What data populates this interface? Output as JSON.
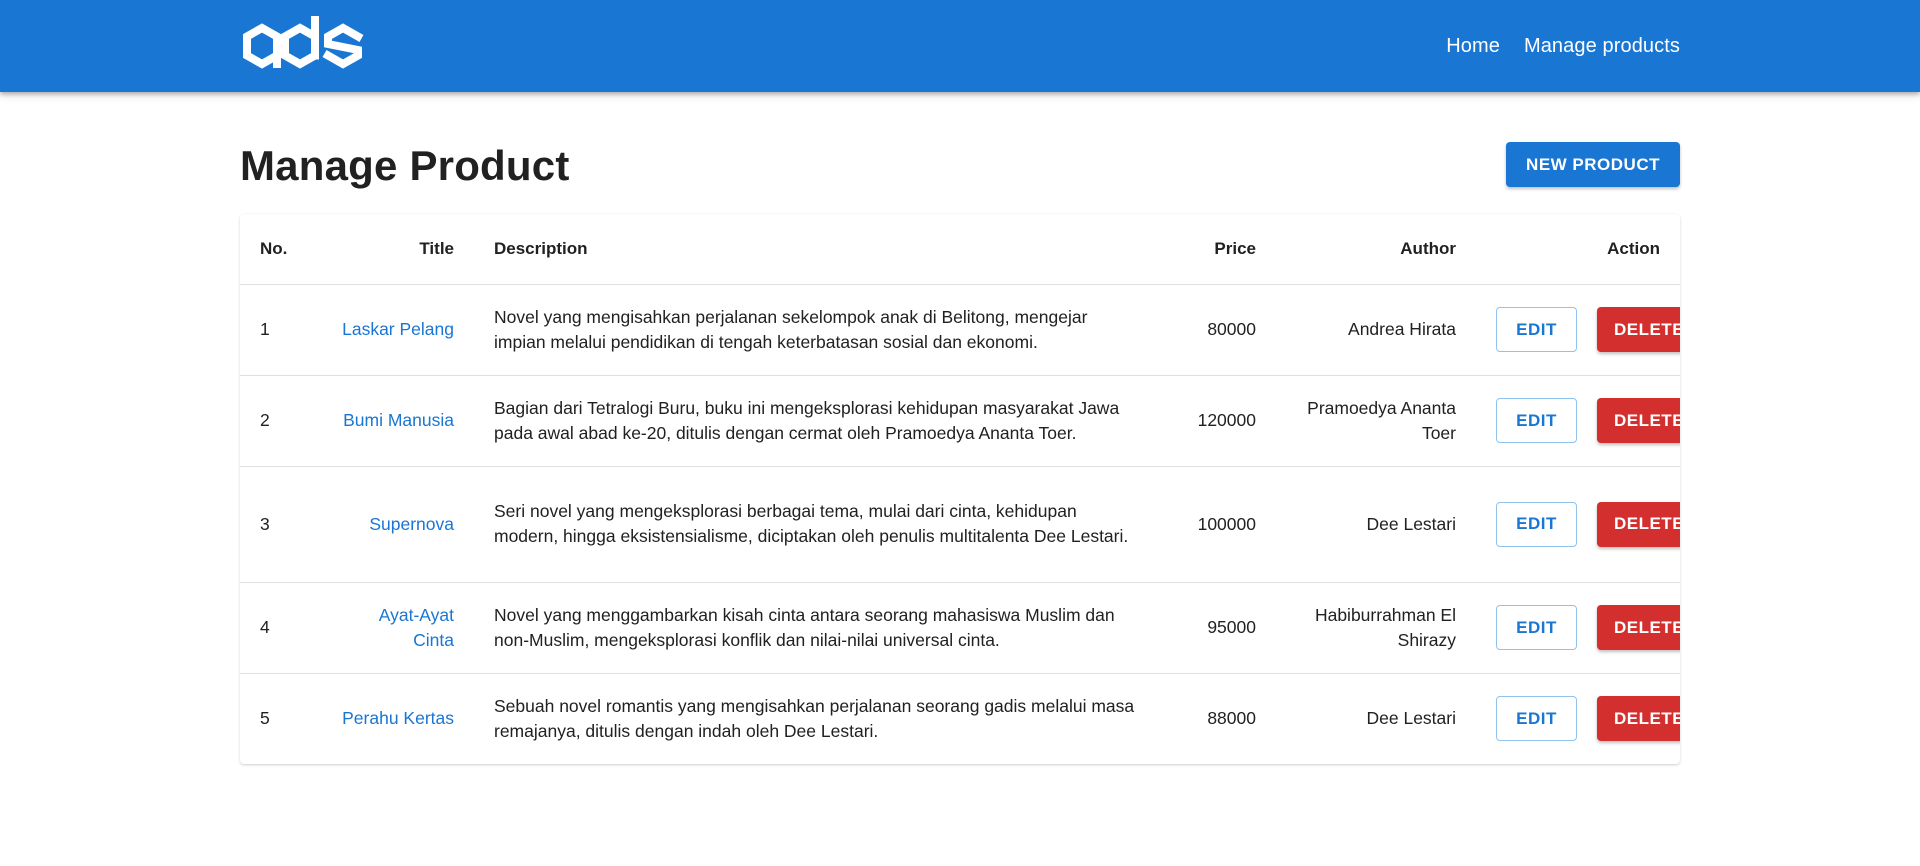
{
  "nav": {
    "links": [
      "Home",
      "Manage products"
    ]
  },
  "page": {
    "title": "Manage Product",
    "new_button": "NEW PRODUCT"
  },
  "table": {
    "headers": {
      "no": "No.",
      "title": "Title",
      "description": "Description",
      "price": "Price",
      "author": "Author",
      "action": "Action"
    },
    "rows": [
      {
        "no": "1",
        "title": "Laskar Pelang",
        "description": "Novel yang mengisahkan perjalanan sekelompok anak di Belitong, mengejar impian melalui pendidikan di tengah keterbatasan sosial dan ekonomi.",
        "price": "80000",
        "author": "Andrea Hirata",
        "edit": "EDIT",
        "delete": "DELETE"
      },
      {
        "no": "2",
        "title": "Bumi Manusia",
        "description": "Bagian dari Tetralogi Buru, buku ini mengeksplorasi kehidupan masyarakat Jawa pada awal abad ke-20, ditulis dengan cermat oleh Pramoedya Ananta Toer.",
        "price": "120000",
        "author": "Pramoedya Ananta Toer",
        "edit": "EDIT",
        "delete": "DELETE"
      },
      {
        "no": "3",
        "title": "Supernova",
        "description": "Seri novel yang mengeksplorasi berbagai tema, mulai dari cinta, kehidupan modern, hingga eksistensialisme, diciptakan oleh penulis multitalenta Dee Lestari.",
        "price": "100000",
        "author": "Dee Lestari",
        "edit": "EDIT",
        "delete": "DELETE"
      },
      {
        "no": "4",
        "title": "Ayat-Ayat Cinta",
        "description": "Novel yang menggambarkan kisah cinta antara seorang mahasiswa Muslim dan non-Muslim, mengeksplorasi konflik dan nilai-nilai universal cinta.",
        "price": "95000",
        "author": "Habiburrahman El Shirazy",
        "edit": "EDIT",
        "delete": "DELETE"
      },
      {
        "no": "5",
        "title": "Perahu Kertas",
        "description": "Sebuah novel romantis yang mengisahkan perjalanan seorang gadis melalui masa remajanya, ditulis dengan indah oleh Dee Lestari.",
        "price": "88000",
        "author": "Dee Lestari",
        "edit": "EDIT",
        "delete": "DELETE"
      }
    ]
  },
  "colors": {
    "primary": "#1976d2",
    "danger": "#d32f2f",
    "text": "#212121",
    "divider": "#e0e0e0"
  },
  "icons": {
    "logo": "ads-logo"
  }
}
